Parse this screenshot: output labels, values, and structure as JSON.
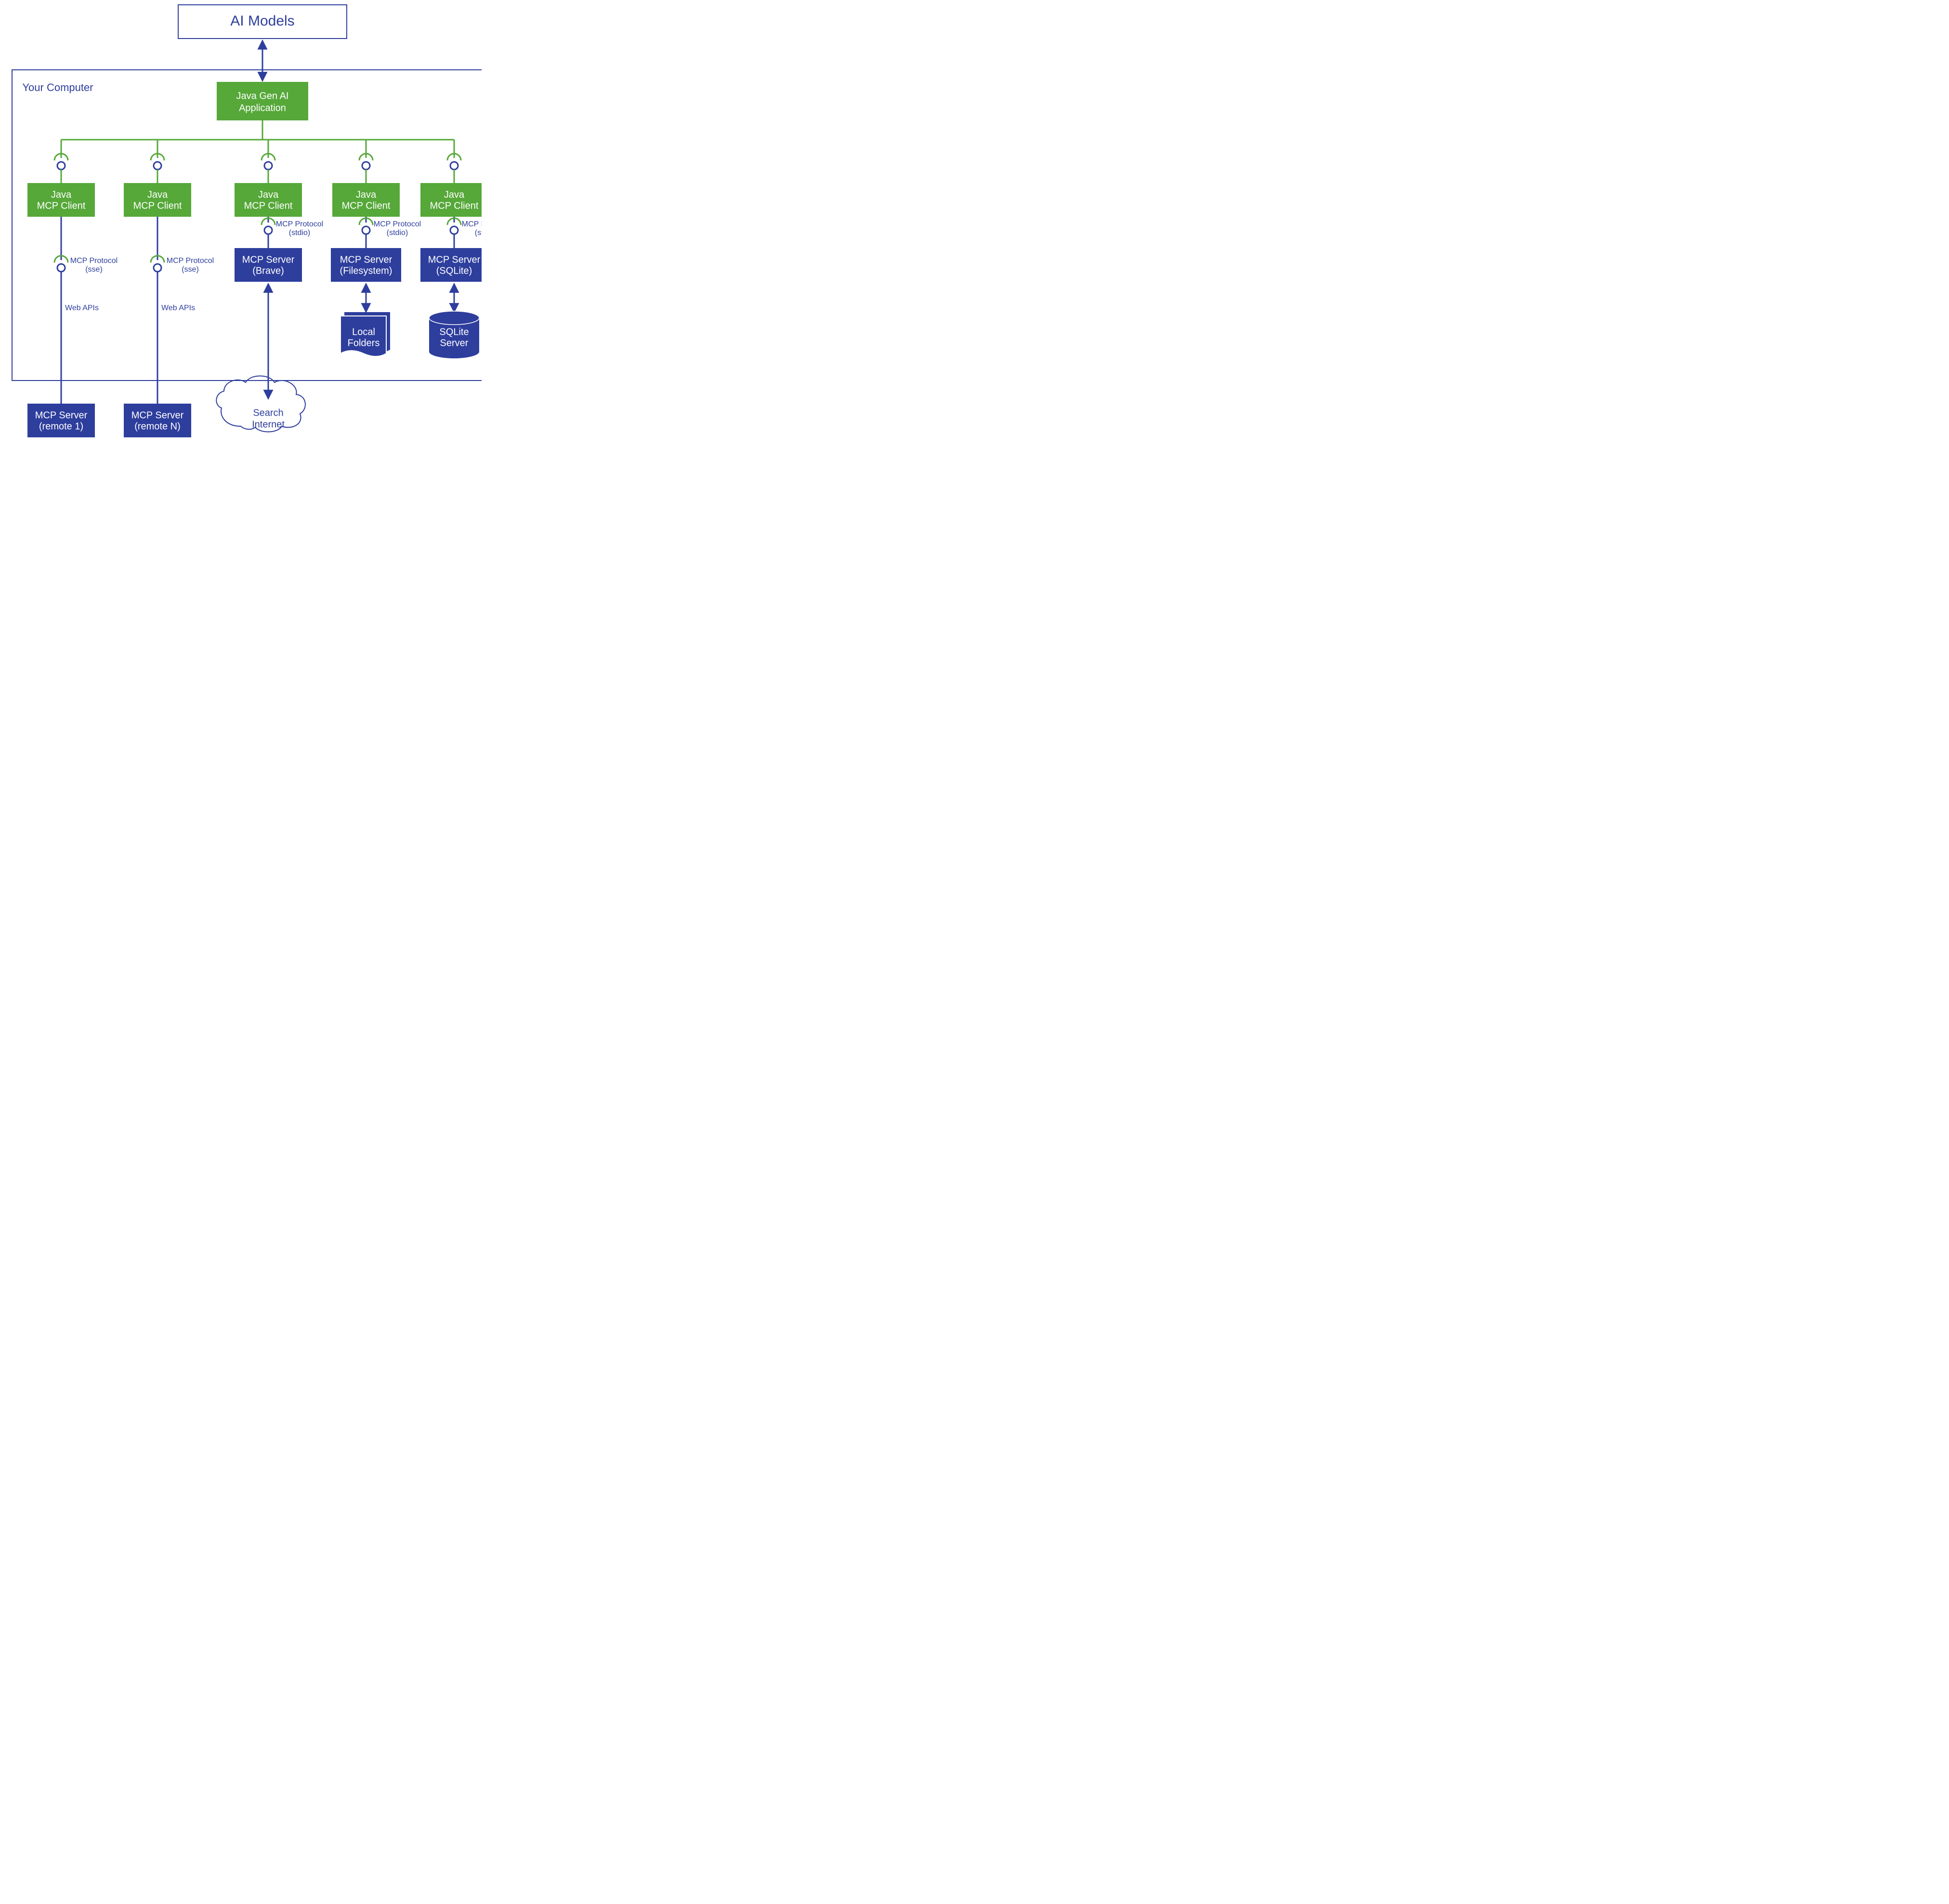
{
  "title_box": {
    "label": "AI Models"
  },
  "container": {
    "label": "Your Computer"
  },
  "app_box": {
    "line1": "Java Gen AI",
    "line2": "Application"
  },
  "clients": [
    {
      "line1": "Java",
      "line2": "MCP Client"
    },
    {
      "line1": "Java",
      "line2": "MCP Client"
    },
    {
      "line1": "Java",
      "line2": "MCP Client"
    },
    {
      "line1": "Java",
      "line2": "MCP Client"
    },
    {
      "line1": "Java",
      "line2": "MCP Client"
    }
  ],
  "protocol_stdio": {
    "line1": "MCP Protocol",
    "line2": "(stdio)"
  },
  "protocol_sse": {
    "line1": "MCP Protocol",
    "line2": "(sse)"
  },
  "web_apis_label": "Web APIs",
  "servers": {
    "remote1": {
      "line1": "MCP Server",
      "line2": "(remote 1)"
    },
    "remoteN": {
      "line1": "MCP Server",
      "line2": "(remote N)"
    },
    "brave": {
      "line1": "MCP Server",
      "line2": "(Brave)"
    },
    "filesystem": {
      "line1": "MCP Server",
      "line2": "(Filesystem)"
    },
    "sqlite": {
      "line1": "MCP Server",
      "line2": "(SQLite)"
    }
  },
  "cloud": {
    "line1": "Search",
    "line2": "Internet"
  },
  "folders": {
    "line1": "Local",
    "line2": "Folders"
  },
  "db": {
    "line1": "SQLite",
    "line2": "Server"
  },
  "colors": {
    "blue": "#2e3e9d",
    "green": "#56a839",
    "white": "#ffffff"
  }
}
